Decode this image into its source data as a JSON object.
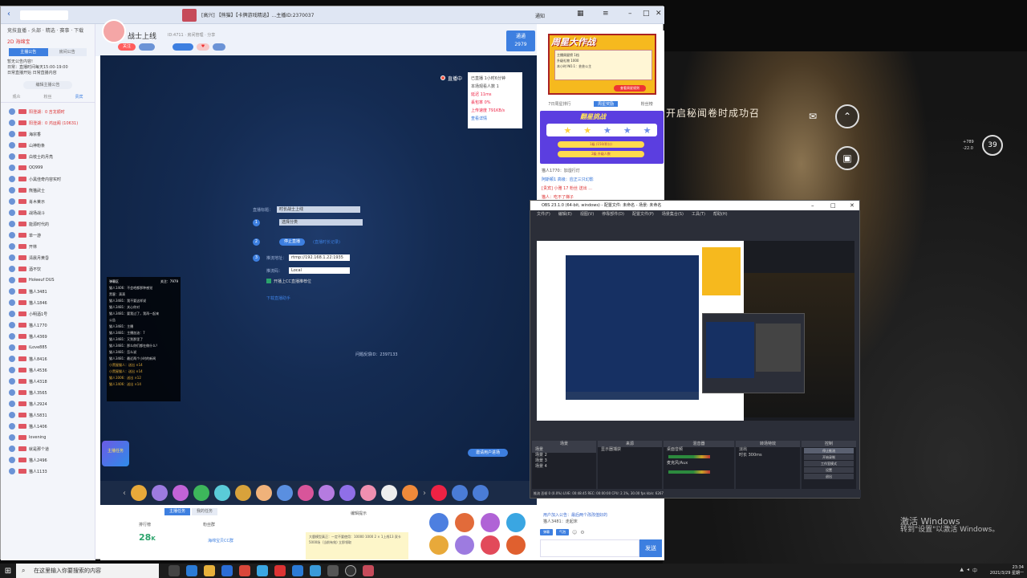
{
  "browser": {
    "tab_title": "[高兴] 【熊猫】【卡牌游戏精选】...主播ID:2370037",
    "notify_label": "通知"
  },
  "room": {
    "anchor_name": "战士上线",
    "room_meta": "ID:4711  ·  房间管理  ·  分享",
    "follow_label": "关注",
    "subscribe_label": "通通",
    "subscribe_count": "2979",
    "live_status": "直播中",
    "stats": [
      {
        "label": "已直播",
        "value": "1小时6分钟"
      },
      {
        "label": "本场观看人数",
        "value": "1"
      },
      {
        "label": "延迟",
        "value": "11ms"
      },
      {
        "label": "丢包率",
        "value": "0%"
      },
      {
        "label": "上传速度",
        "value": "791KB/s"
      },
      {
        "label": "查看详情",
        "value": ""
      }
    ],
    "push_form": {
      "title_label": "直播标题：",
      "title_value": "时长战士上线",
      "step1_value": "选择分类",
      "stop_label": "停止直播",
      "stop_hint": "(直播时长记录)",
      "rtmp_label": "推流地址：",
      "rtmp_value": "rtmp://192.168.1.22:1935",
      "key_label": "推流码：",
      "key_value": "Local",
      "checkbox_label": "开播上CC直播推荐位",
      "link_label": "下载直播助手",
      "server_label": "问题反馈ID：2397133"
    },
    "chat_overlay": {
      "header_left": "弹幕区",
      "header_right": "关注：7979",
      "messages": [
        "猫人1406：不会吧都那种感觉",
        "黑客：滴滴",
        "猫人3481：我不要这样说",
        "猫人3481：关心你对",
        "猫人3481：要我过了，我再一起来",
        "公告",
        "猫人3481：主播",
        "猫人3481：主播加油：7",
        "猫人3481：又到那里了",
        "猫人3481：那么你们都在做什么？",
        "猫人3481：怎么说",
        "猫人3481：最近两个小时的新闻",
        "小黑屋猫人：送出 ×14",
        "小黑屋猫人：送出 ×14",
        "猫人1006：送出 ×12",
        "猫人1406：送出 ×14"
      ]
    },
    "task_badge": "主播任务",
    "invite_label": "邀请用户进场"
  },
  "sidebar": {
    "head": "竞技直播 - 头部  ·  精选 · 赛事 · 下载",
    "anchor_tag": "2D 海绵宝",
    "tabs": [
      "主播公告",
      "房间公告"
    ],
    "notice_lines": [
      "暂无公告内容!",
      "日常：直播时间每天15:00-19:00",
      "日常直播开始 日常直播内容"
    ],
    "sub_title": "编辑主播公告",
    "tabs2": [
      "观众",
      "粉丝",
      "贵宾"
    ],
    "users": [
      {
        "name": "阳澄湖：0  吉龙顺时",
        "red": true
      },
      {
        "name": "阳澄湖：0  鸿运阁 (10631)",
        "red": true
      },
      {
        "name": "海宗香",
        "red": false
      },
      {
        "name": "山神粉条",
        "red": false
      },
      {
        "name": "白枝士的月亮",
        "red": false
      },
      {
        "name": "QQ999",
        "red": false
      },
      {
        "name": "小黑佳奇内容实时",
        "red": false
      },
      {
        "name": "熊猫武士",
        "red": false
      },
      {
        "name": "肖木莱示",
        "red": false
      },
      {
        "name": "战场战斗",
        "red": false
      },
      {
        "name": "能源时代的",
        "red": false
      },
      {
        "name": "单一游",
        "red": false
      },
      {
        "name": "开林",
        "red": false
      },
      {
        "name": "清晨月黄昏",
        "red": false
      },
      {
        "name": "酒不饮",
        "red": false
      },
      {
        "name": "Holeeuf DUS",
        "red": false
      },
      {
        "name": "猫人3481",
        "red": false
      },
      {
        "name": "猫人1846",
        "red": false
      },
      {
        "name": "小明酒1号",
        "red": false
      },
      {
        "name": "猫人1770",
        "red": false
      },
      {
        "name": "猫人4369",
        "red": false
      },
      {
        "name": "iLove885",
        "red": false
      },
      {
        "name": "猫人8416",
        "red": false
      },
      {
        "name": "猫人4536",
        "red": false
      },
      {
        "name": "猫人4318",
        "red": false
      },
      {
        "name": "猫人3565",
        "red": false
      },
      {
        "name": "猫人2924",
        "red": false
      },
      {
        "name": "猫人5831",
        "red": false
      },
      {
        "name": "猫人1406",
        "red": false
      },
      {
        "name": "lovening",
        "red": false
      },
      {
        "name": "就是那个道",
        "red": false
      },
      {
        "name": "猫人2496",
        "red": false
      },
      {
        "name": "猫人1133",
        "red": false
      }
    ],
    "footer": "设置主播..."
  },
  "bottom_panel": {
    "tabs": [
      "主播任务",
      "我的任务"
    ],
    "rank_label": "排行榜",
    "fans_label": "粉丝群",
    "big_number": "28",
    "big_unit": "K",
    "fans_link": "海绵宝贝CC群",
    "edit_label": "编辑提示",
    "note": "大鹿模型真正：一定不要使用：10000 1000 2 × 1上线13 双卡5000场（当前有效) 立即领取"
  },
  "right_panel": {
    "event_title": "周星大作战",
    "event_lines": [
      "主播周星榜  1档",
      "升级礼物  1000",
      "本小时 NO.1：芸芸公主"
    ],
    "event_btn": "查看周星规则",
    "tabs": [
      "7日周星排行",
      "周星奖励",
      "粉丝榜"
    ],
    "lottery_title": "翻星挑战",
    "lottery_bar1": "1级 (150/积分)",
    "lottery_bar2": "2级 升级人数",
    "messages": [
      {
        "text": "猫人1770：加湿行灯",
        "cls": ""
      },
      {
        "text": "阿斯顿1  高级：应正三只幻影",
        "cls": "blue"
      },
      {
        "text": "[贵宾] 小雅 17  粉丝  送出 ...",
        "cls": "red"
      },
      {
        "text": "猫人：吃不了梯子",
        "cls": "red"
      }
    ],
    "bottom_msg": "用户加入公告：最后两个改改值好的",
    "bottom_user": "猫人3481：走起床",
    "pills": [
      "弹幕",
      "气泡"
    ],
    "input_placeholder": "",
    "send_label": "发送"
  },
  "obs": {
    "title": "OBS 23.1.0 (64-bit, windows) - 配置文件: 未命名 - 场景: 未命名",
    "menu": [
      "文件(F)",
      "编辑(E)",
      "视图(V)",
      "停靠部件(D)",
      "配置文件(P)",
      "场景集合(S)",
      "工具(T)",
      "帮助(H)"
    ],
    "docks": [
      "场景",
      "来源",
      "混音器",
      "转场特效",
      "控制"
    ],
    "scenes": [
      "场景",
      "场景 2",
      "场景 3",
      "场景 4"
    ],
    "sources": [
      "显示器捕获"
    ],
    "mixer": [
      "桌面音频",
      "麦克风/Aux"
    ],
    "transition": [
      "淡出",
      "时长 300ms"
    ],
    "controls": [
      "停止推流",
      "开始录制",
      "工作室模式",
      "设置",
      "退出"
    ],
    "status": "推流 丢帧 0 (0.0%)   LIVE: 00:48:45   REC: 00:00:00   CPU: 2.1%, 30.00 fps   kb/s: 6267"
  },
  "game": {
    "banner": "开启秘闻卷时成功召",
    "level": "39",
    "stats": [
      "+789",
      "-22.0"
    ]
  },
  "activate": {
    "line1": "激活 Windows",
    "line2": "转到\"设置\"以激活 Windows。"
  },
  "taskbar": {
    "search_placeholder": "在这里输入你要搜索的内容",
    "time": "23:34",
    "date": "2021/3/29 星期一"
  },
  "colors": {
    "accent": "#3d7fe0",
    "video_bg": "#142b52",
    "event_yellow": "#f6b91e",
    "lottery_purple": "#5b3ee0"
  }
}
